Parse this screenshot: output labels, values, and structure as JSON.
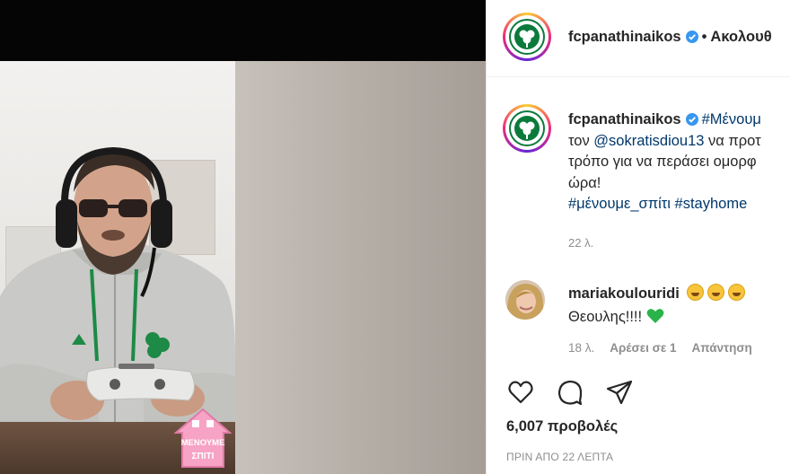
{
  "post": {
    "username": "fcpanathinaikos",
    "follow_label": "Ακολουθ",
    "dot": "•",
    "caption": {
      "hashtag_1": "#Μένουμ",
      "line_2_prefix": "τον ",
      "mention": "@sokratisdiou13",
      "line_2_suffix": " να προτ",
      "line_3": "τρόπο για να περάσει ομορφ",
      "line_4": "ώρα!",
      "hashtag_2": "#μένουμε_σπίτι",
      "hashtag_3": "#stayhome",
      "time": "22 λ."
    },
    "comment": {
      "username": "mariakoulouridi",
      "text": "Θεουλης!!!!",
      "time": "18 λ.",
      "likes": "Αρέσει σε 1",
      "reply": "Απάντηση"
    },
    "views": "6,007 προβολές",
    "posted_time": "ΠΡΙΝ ΑΠΟ 22 ΛΕΠΤΑ"
  },
  "video": {
    "sticker_text_1": "ΜΕΝΟΥΜΕ",
    "sticker_text_2": "ΣΠΙΤΙ"
  },
  "icons": [
    "heart-icon",
    "comment-icon",
    "share-icon",
    "verified-icon",
    "shamrock-logo",
    "green-heart-icon"
  ],
  "colors": {
    "brand_green": "#0b7a3b",
    "verified_blue": "#3897f0",
    "link_blue": "#00376b",
    "text": "#262626",
    "muted": "#8e8e8e",
    "sticker_pink": "#f7a3c5"
  }
}
